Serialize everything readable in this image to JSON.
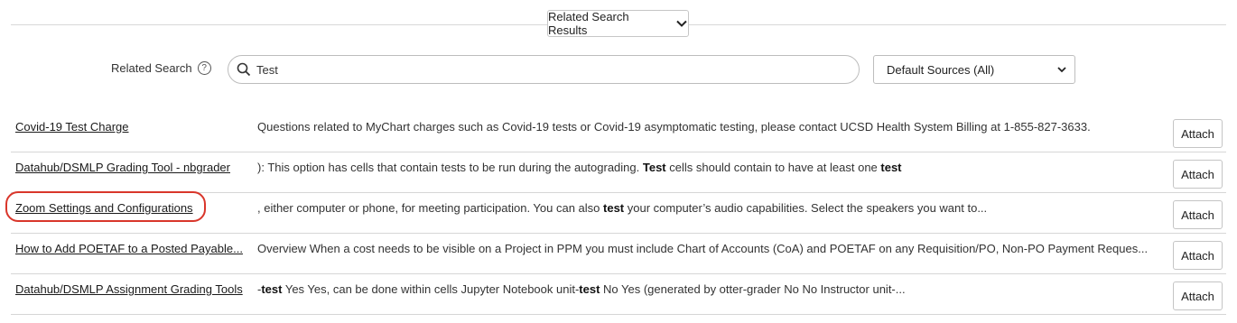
{
  "header": {
    "related_results_label": "Related Search Results"
  },
  "search": {
    "label": "Related Search",
    "query": "Test",
    "source_selected": "Default Sources (All)"
  },
  "results": [
    {
      "title": "Covid-19 Test Charge",
      "snippet_parts": [
        {
          "t": "Questions related to MyChart charges such as Covid-19 tests or Covid-19 asymptomatic testing, please contact UCSD Health System Billing at 1-855-827-3633.",
          "b": false
        }
      ],
      "action": "Attach"
    },
    {
      "title": "Datahub/DSMLP Grading Tool - nbgrader",
      "snippet_parts": [
        {
          "t": "): This option has cells that contain tests to be run during the autograding. ",
          "b": false
        },
        {
          "t": "Test",
          "b": true
        },
        {
          "t": " cells should contain to have at least one ",
          "b": false
        },
        {
          "t": "test",
          "b": true
        }
      ],
      "action": "Attach"
    },
    {
      "title": "Zoom Settings and Configurations",
      "snippet_parts": [
        {
          "t": ", either computer or phone, for meeting participation. You can also ",
          "b": false
        },
        {
          "t": "test",
          "b": true
        },
        {
          "t": " your computer’s audio capabilities. Select the speakers you want to...",
          "b": false
        }
      ],
      "action": "Attach"
    },
    {
      "title": "How to Add POETAF to a Posted Payable...",
      "snippet_parts": [
        {
          "t": "Overview When a cost needs to be visible on a Project in PPM you must include Chart of Accounts (CoA) and POETAF on any Requisition/PO, Non-PO Payment Reques...",
          "b": false
        }
      ],
      "action": "Attach"
    },
    {
      "title": "Datahub/DSMLP Assignment Grading Tools",
      "snippet_parts": [
        {
          "t": "-",
          "b": false
        },
        {
          "t": "test",
          "b": true
        },
        {
          "t": " Yes Yes, can be done within cells Jupyter Notebook unit-",
          "b": false
        },
        {
          "t": "test",
          "b": true
        },
        {
          "t": " No Yes (generated by otter-grader No No Instructor unit-...",
          "b": false
        }
      ],
      "action": "Attach"
    }
  ]
}
